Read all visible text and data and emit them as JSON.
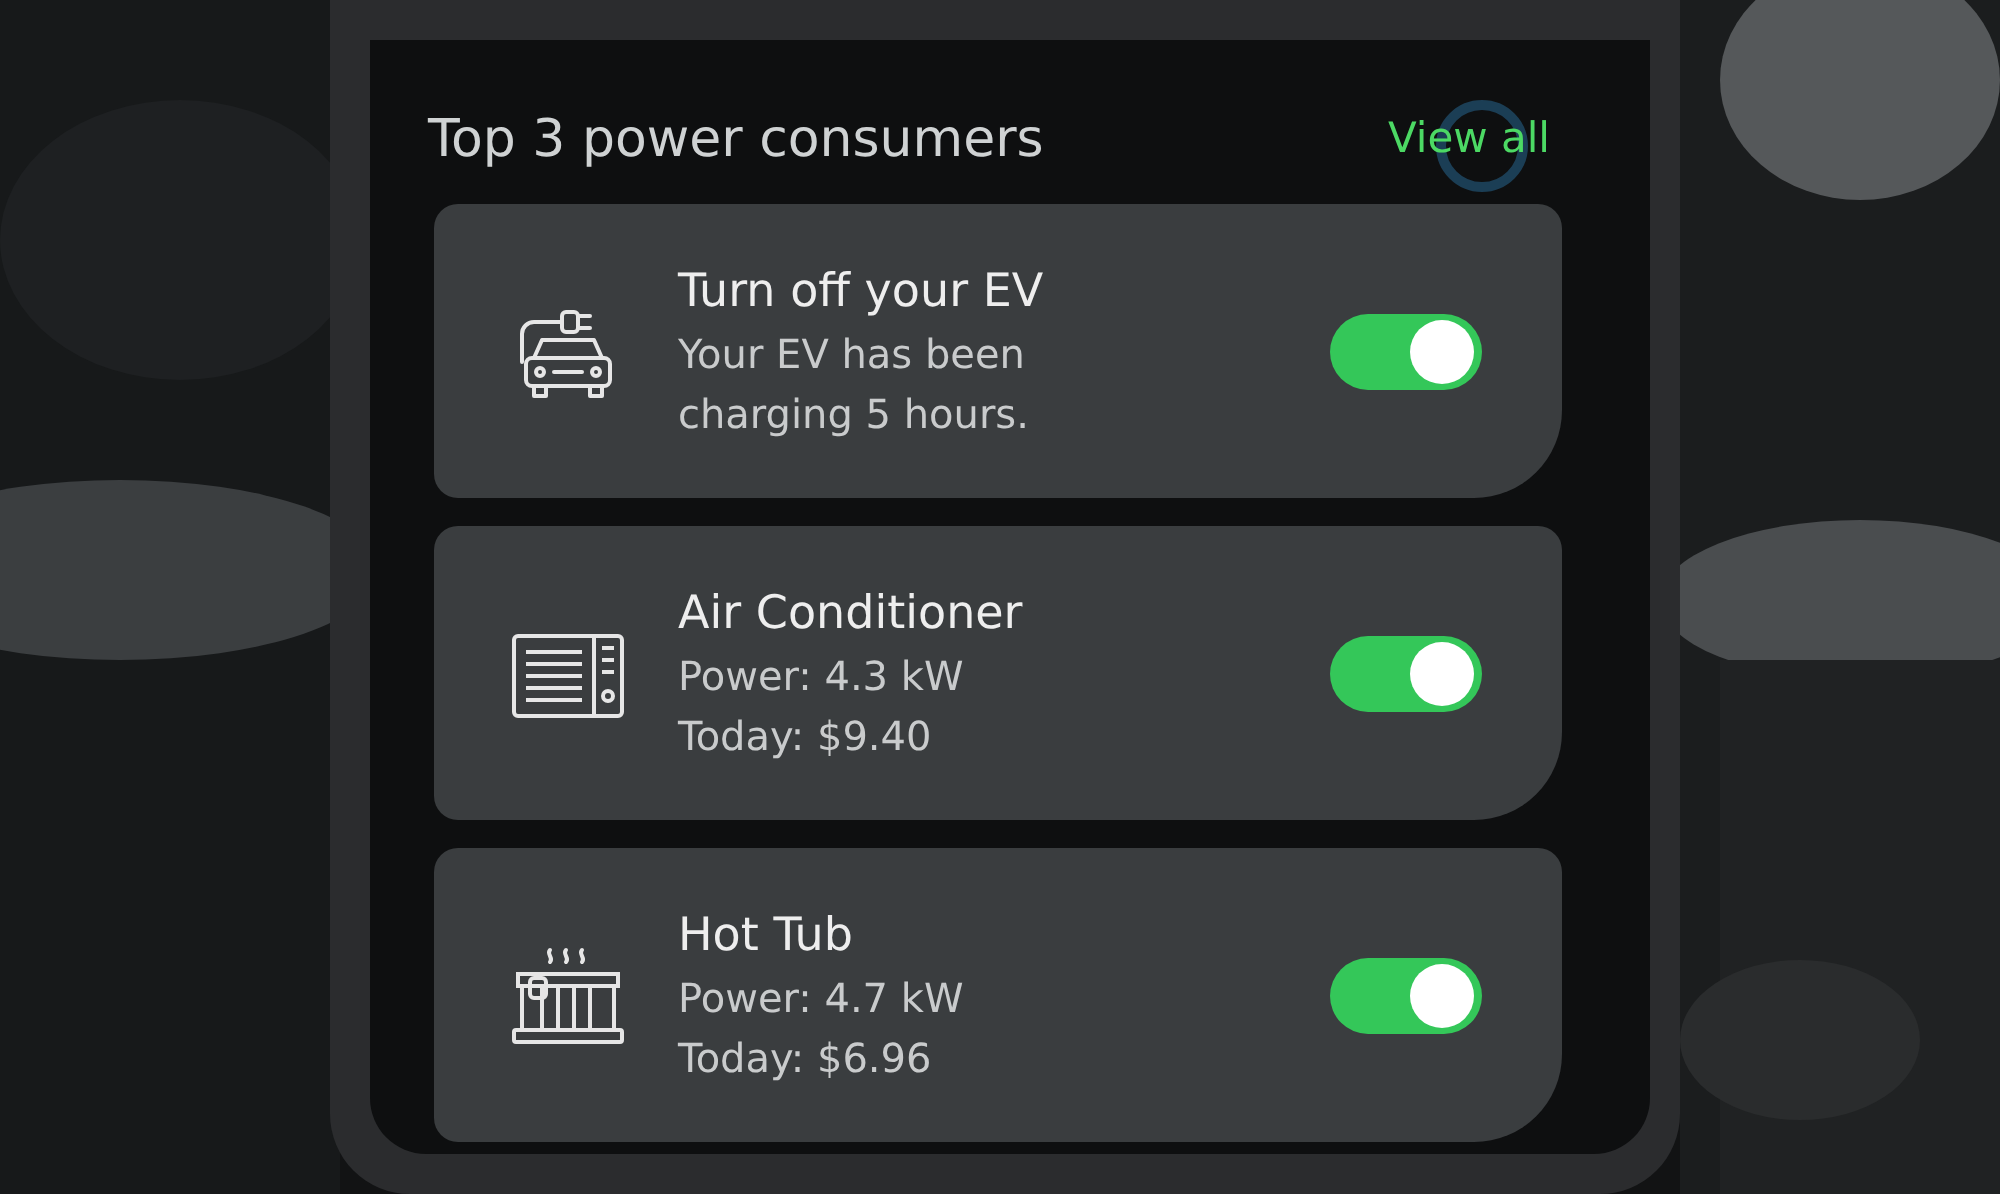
{
  "section": {
    "title": "Top 3 power consumers",
    "link": "View all"
  },
  "consumers": [
    {
      "kind": "ev",
      "title": "Turn off your EV",
      "lines": [
        "Your EV has been",
        "charging 5 hours."
      ],
      "on": true
    },
    {
      "kind": "ac",
      "title": "Air Conditioner",
      "lines": [
        "Power: 4.3 kW",
        "Today: $9.40"
      ],
      "on": true
    },
    {
      "kind": "tub",
      "title": "Hot Tub",
      "lines": [
        "Power: 4.7 kW",
        "Today: $6.96"
      ],
      "on": true
    }
  ]
}
